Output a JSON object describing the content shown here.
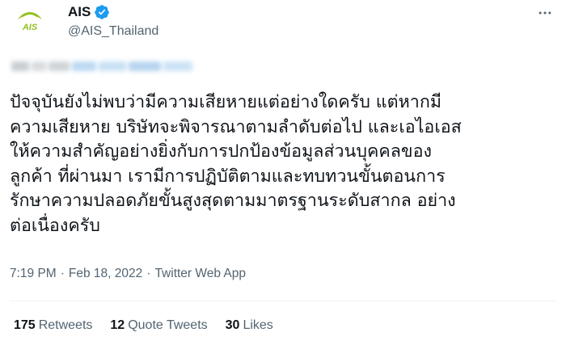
{
  "account": {
    "display_name": "AIS",
    "handle": "@AIS_Thailand",
    "logo_text": "AIS",
    "verified": true,
    "avatar_icon": "ais-logo-icon",
    "verified_icon": "verified-badge-icon"
  },
  "more_icon": "more-options-icon",
  "tweet": {
    "text": "ปัจจุบันยังไม่พบว่ามีความเสียหายแต่อย่างใดครับ แต่หากมี\nความเสียหาย บริษัทจะพิจารณาตามลำดับต่อไป และเอไอเอส\nให้ความสำคัญอย่างยิ่งกับการปกป้องข้อมูลส่วนบุคคลของ\nลูกค้า ที่ผ่านมา เรามีการปฏิบัติตามและทบทวนขั้นตอนการ\nรักษาความปลอดภัยขั้นสูงสุดตามมาตรฐานระดับสากล อย่าง\nต่อเนื่องครับ",
    "time": "7:19 PM",
    "separator": "·",
    "date": "Feb 18, 2022",
    "source": "Twitter Web App"
  },
  "stats": {
    "retweets_count": "175",
    "retweets_label": "Retweets",
    "quotes_count": "12",
    "quotes_label": "Quote Tweets",
    "likes_count": "30",
    "likes_label": "Likes"
  },
  "colors": {
    "text": "#0f1419",
    "secondary": "#536471",
    "verified_blue": "#1d9bf0",
    "ais_green": "#93c01f"
  }
}
